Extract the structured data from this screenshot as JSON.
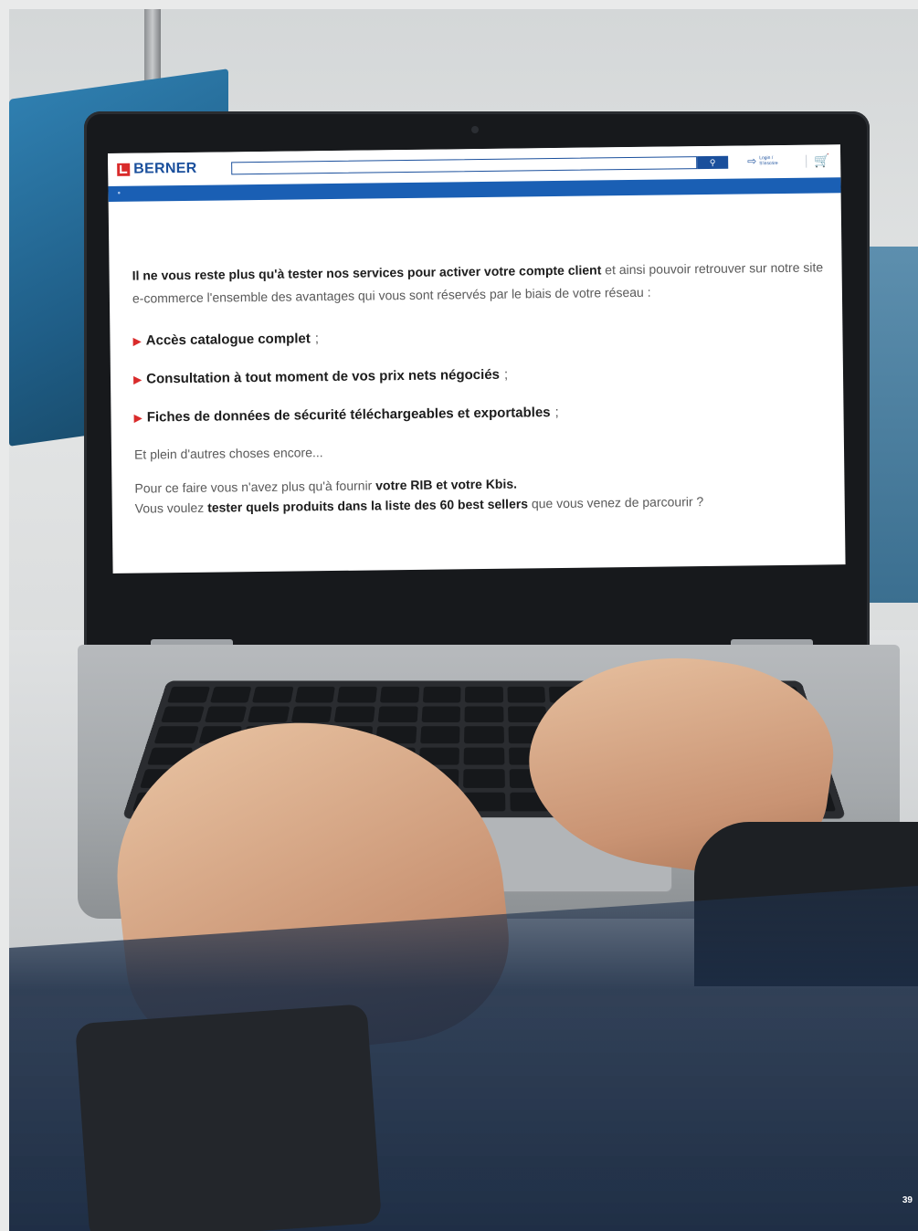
{
  "site": {
    "logo_text": "BERNER",
    "search_button_icon": "search-icon",
    "login_line1": "Login /",
    "login_line2": "S'inscrire",
    "cart_icon": "cart-icon"
  },
  "content": {
    "intro_bold": "Il ne vous reste plus qu'à tester nos services pour activer votre compte client",
    "intro_rest": " et ainsi pouvoir retrouver sur notre site e-commerce l'ensemble des avantages qui vous sont réservés par le biais de votre réseau :",
    "bullets": [
      {
        "text": "Accès catalogue complet",
        "punct": " ;"
      },
      {
        "text": "Consultation à tout moment de vos prix nets négociés",
        "punct": " ;"
      },
      {
        "text": "Fiches de données de sécurité téléchargeables et exportables",
        "punct": " ;"
      }
    ],
    "more": "Et plein d'autres choses encore...",
    "rib_prefix": "Pour ce faire vous n'avez plus qu'à fournir ",
    "rib_bold": "votre RIB et votre Kbis.",
    "test_prefix": "Vous voulez ",
    "test_bold": "tester quels produits dans la liste des 60 best sellers",
    "test_suffix": " que vous venez de parcourir ?"
  },
  "page_number": "39",
  "colors": {
    "brand_blue": "#1a5fb4",
    "brand_red": "#d92b2b",
    "band_navy": "#1c2d46"
  }
}
